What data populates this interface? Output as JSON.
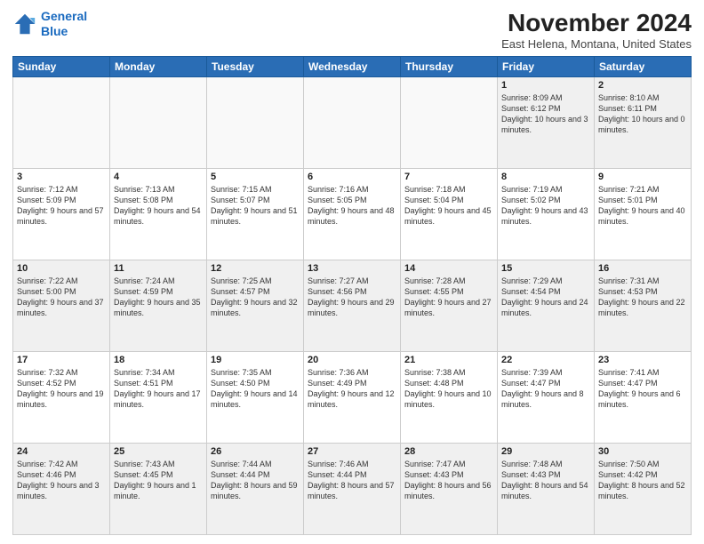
{
  "header": {
    "logo_line1": "General",
    "logo_line2": "Blue",
    "month": "November 2024",
    "location": "East Helena, Montana, United States"
  },
  "weekdays": [
    "Sunday",
    "Monday",
    "Tuesday",
    "Wednesday",
    "Thursday",
    "Friday",
    "Saturday"
  ],
  "weeks": [
    [
      {
        "day": "",
        "info": ""
      },
      {
        "day": "",
        "info": ""
      },
      {
        "day": "",
        "info": ""
      },
      {
        "day": "",
        "info": ""
      },
      {
        "day": "",
        "info": ""
      },
      {
        "day": "1",
        "info": "Sunrise: 8:09 AM\nSunset: 6:12 PM\nDaylight: 10 hours and 3 minutes."
      },
      {
        "day": "2",
        "info": "Sunrise: 8:10 AM\nSunset: 6:11 PM\nDaylight: 10 hours and 0 minutes."
      }
    ],
    [
      {
        "day": "3",
        "info": "Sunrise: 7:12 AM\nSunset: 5:09 PM\nDaylight: 9 hours and 57 minutes."
      },
      {
        "day": "4",
        "info": "Sunrise: 7:13 AM\nSunset: 5:08 PM\nDaylight: 9 hours and 54 minutes."
      },
      {
        "day": "5",
        "info": "Sunrise: 7:15 AM\nSunset: 5:07 PM\nDaylight: 9 hours and 51 minutes."
      },
      {
        "day": "6",
        "info": "Sunrise: 7:16 AM\nSunset: 5:05 PM\nDaylight: 9 hours and 48 minutes."
      },
      {
        "day": "7",
        "info": "Sunrise: 7:18 AM\nSunset: 5:04 PM\nDaylight: 9 hours and 45 minutes."
      },
      {
        "day": "8",
        "info": "Sunrise: 7:19 AM\nSunset: 5:02 PM\nDaylight: 9 hours and 43 minutes."
      },
      {
        "day": "9",
        "info": "Sunrise: 7:21 AM\nSunset: 5:01 PM\nDaylight: 9 hours and 40 minutes."
      }
    ],
    [
      {
        "day": "10",
        "info": "Sunrise: 7:22 AM\nSunset: 5:00 PM\nDaylight: 9 hours and 37 minutes."
      },
      {
        "day": "11",
        "info": "Sunrise: 7:24 AM\nSunset: 4:59 PM\nDaylight: 9 hours and 35 minutes."
      },
      {
        "day": "12",
        "info": "Sunrise: 7:25 AM\nSunset: 4:57 PM\nDaylight: 9 hours and 32 minutes."
      },
      {
        "day": "13",
        "info": "Sunrise: 7:27 AM\nSunset: 4:56 PM\nDaylight: 9 hours and 29 minutes."
      },
      {
        "day": "14",
        "info": "Sunrise: 7:28 AM\nSunset: 4:55 PM\nDaylight: 9 hours and 27 minutes."
      },
      {
        "day": "15",
        "info": "Sunrise: 7:29 AM\nSunset: 4:54 PM\nDaylight: 9 hours and 24 minutes."
      },
      {
        "day": "16",
        "info": "Sunrise: 7:31 AM\nSunset: 4:53 PM\nDaylight: 9 hours and 22 minutes."
      }
    ],
    [
      {
        "day": "17",
        "info": "Sunrise: 7:32 AM\nSunset: 4:52 PM\nDaylight: 9 hours and 19 minutes."
      },
      {
        "day": "18",
        "info": "Sunrise: 7:34 AM\nSunset: 4:51 PM\nDaylight: 9 hours and 17 minutes."
      },
      {
        "day": "19",
        "info": "Sunrise: 7:35 AM\nSunset: 4:50 PM\nDaylight: 9 hours and 14 minutes."
      },
      {
        "day": "20",
        "info": "Sunrise: 7:36 AM\nSunset: 4:49 PM\nDaylight: 9 hours and 12 minutes."
      },
      {
        "day": "21",
        "info": "Sunrise: 7:38 AM\nSunset: 4:48 PM\nDaylight: 9 hours and 10 minutes."
      },
      {
        "day": "22",
        "info": "Sunrise: 7:39 AM\nSunset: 4:47 PM\nDaylight: 9 hours and 8 minutes."
      },
      {
        "day": "23",
        "info": "Sunrise: 7:41 AM\nSunset: 4:47 PM\nDaylight: 9 hours and 6 minutes."
      }
    ],
    [
      {
        "day": "24",
        "info": "Sunrise: 7:42 AM\nSunset: 4:46 PM\nDaylight: 9 hours and 3 minutes."
      },
      {
        "day": "25",
        "info": "Sunrise: 7:43 AM\nSunset: 4:45 PM\nDaylight: 9 hours and 1 minute."
      },
      {
        "day": "26",
        "info": "Sunrise: 7:44 AM\nSunset: 4:44 PM\nDaylight: 8 hours and 59 minutes."
      },
      {
        "day": "27",
        "info": "Sunrise: 7:46 AM\nSunset: 4:44 PM\nDaylight: 8 hours and 57 minutes."
      },
      {
        "day": "28",
        "info": "Sunrise: 7:47 AM\nSunset: 4:43 PM\nDaylight: 8 hours and 56 minutes."
      },
      {
        "day": "29",
        "info": "Sunrise: 7:48 AM\nSunset: 4:43 PM\nDaylight: 8 hours and 54 minutes."
      },
      {
        "day": "30",
        "info": "Sunrise: 7:50 AM\nSunset: 4:42 PM\nDaylight: 8 hours and 52 minutes."
      }
    ]
  ]
}
